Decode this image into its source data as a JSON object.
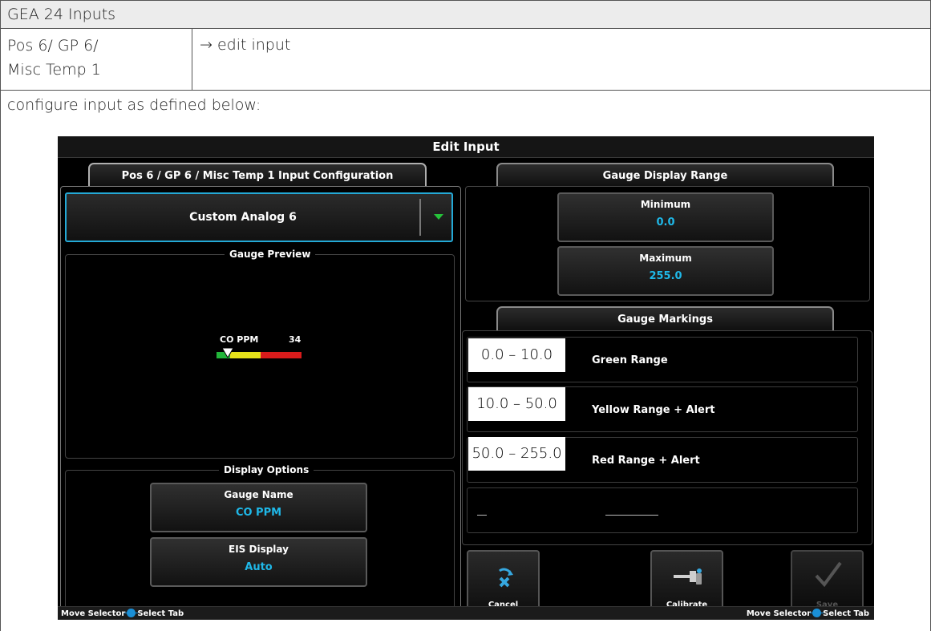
{
  "doc": {
    "title": "GEA 24 Inputs",
    "position_line1": "Pos 6/ GP 6/",
    "position_line2": "Misc Temp 1",
    "action": "→ edit input",
    "instruction": "configure input as defined below:"
  },
  "screen": {
    "title": "Edit Input",
    "left_tab": "Pos 6 / GP 6 / Misc Temp 1 Input Configuration",
    "input_type": "Custom Analog 6",
    "gauge_preview": {
      "title": "Gauge Preview",
      "gauge_name": "CO PPM",
      "gauge_value": "34",
      "pointer_fraction": 0.133
    },
    "display_options": {
      "title": "Display Options",
      "gauge_name_label": "Gauge Name",
      "gauge_name_value": "CO PPM",
      "eis_display_label": "EIS Display",
      "eis_display_value": "Auto"
    },
    "gauge_display_range": {
      "tab": "Gauge Display Range",
      "minimum_label": "Minimum",
      "minimum_value": "0.0",
      "maximum_label": "Maximum",
      "maximum_value": "255.0"
    },
    "gauge_markings": {
      "tab": "Gauge Markings",
      "rows": [
        {
          "range": "0.0 – 10.0",
          "label": "Green Range"
        },
        {
          "range": "10.0 – 50.0",
          "label": "Yellow Range + Alert"
        },
        {
          "range": "50.0 – 255.0",
          "label": "Red Range + Alert"
        }
      ]
    },
    "buttons": {
      "cancel": "Cancel",
      "calibrate": "Calibrate",
      "save": "Save"
    },
    "footer": {
      "left_a": "Move Selector",
      "left_b": "Select Tab",
      "right_a": "Move Selector",
      "right_b": "Select Tab"
    },
    "colors": {
      "accent": "#1fb8e8",
      "selection_border": "#24a9d6",
      "green": "#22b53a",
      "yellow": "#e6e21a",
      "red": "#d81b1b"
    }
  }
}
